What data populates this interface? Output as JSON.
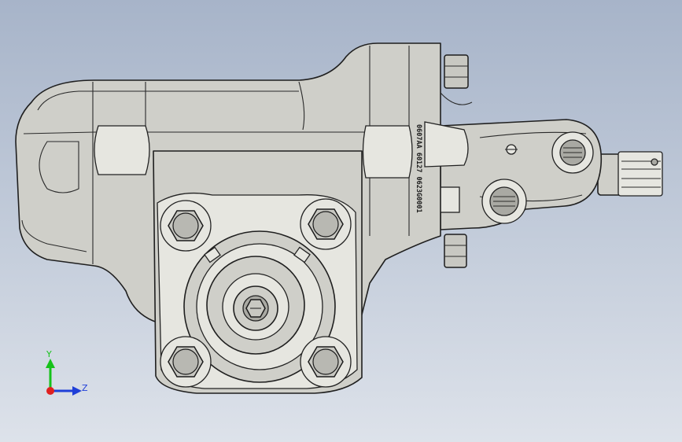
{
  "viewport": {
    "background_top": "#a7b4c9",
    "background_bottom": "#dde2ea",
    "part_color": "#cfcfc9",
    "edge_color": "#1f1f1f"
  },
  "part_marking": {
    "text": "0607AA 60127 0623G0001"
  },
  "triad": {
    "y_label": "Y",
    "z_label": "Z",
    "y_color": "#16c21a",
    "z_color": "#1f3fd8",
    "x_color": "#e02020"
  }
}
